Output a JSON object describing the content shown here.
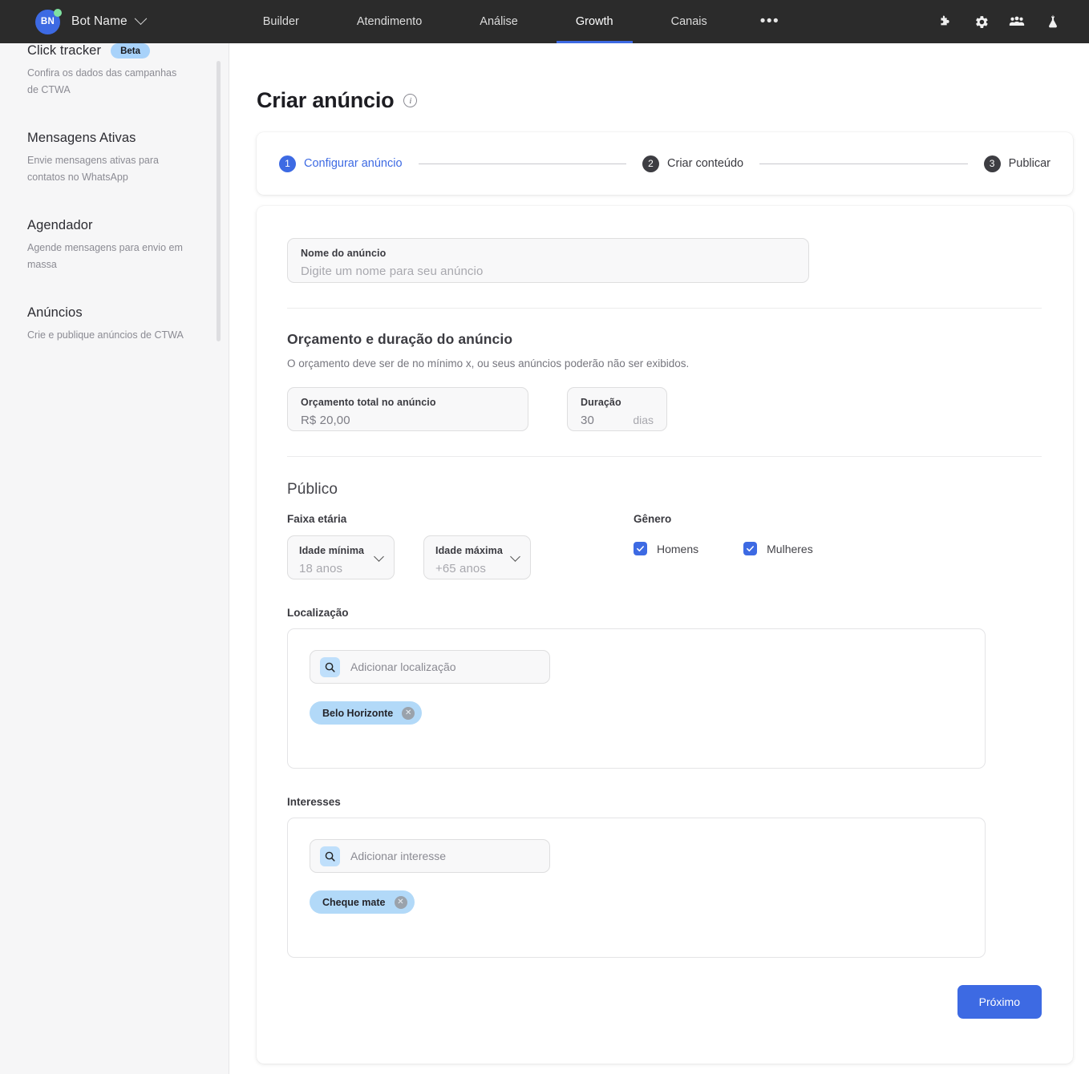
{
  "topnav": {
    "avatar_initials": "BN",
    "brand_name": "Bot Name",
    "items": [
      {
        "label": "Builder",
        "active": false
      },
      {
        "label": "Atendimento",
        "active": false
      },
      {
        "label": "Análise",
        "active": false
      },
      {
        "label": "Growth",
        "active": true
      },
      {
        "label": "Canais",
        "active": false
      }
    ],
    "more_label": "•••",
    "icons": [
      "puzzle-icon",
      "gear-icon",
      "people-icon",
      "flask-icon"
    ],
    "accent_color": "#3d6ae3",
    "background_color": "#2b2b2b",
    "status_dot_color": "#7fe2a1"
  },
  "sidebar": {
    "items": [
      {
        "title": "Click tracker",
        "badge": "Beta",
        "desc": "Confira os dados das campanhas de CTWA"
      },
      {
        "title": "Mensagens Ativas",
        "badge": "",
        "desc": "Envie mensagens ativas para contatos no WhatsApp"
      },
      {
        "title": "Agendador",
        "badge": "",
        "desc": "Agende mensagens para envio em massa"
      },
      {
        "title": "Anúncios",
        "badge": "",
        "desc": "Crie e publique anúncios de CTWA"
      }
    ]
  },
  "page": {
    "title": "Criar anúncio",
    "info_icon": "info-icon"
  },
  "stepper": {
    "steps": [
      {
        "number": "1",
        "label": "Configurar anúncio",
        "state": "active"
      },
      {
        "number": "2",
        "label": "Criar conteúdo",
        "state": "idle"
      },
      {
        "number": "3",
        "label": "Publicar",
        "state": "idle"
      }
    ]
  },
  "form": {
    "name_field": {
      "label": "Nome do anúncio",
      "placeholder": "Digite um nome para seu anúncio",
      "value": ""
    },
    "budget_section": {
      "title": "Orçamento e duração do anúncio",
      "subtitle": "O orçamento deve ser de no mínimo x, ou seus anúncios poderão não ser exibidos.",
      "budget": {
        "label": "Orçamento total no anúncio",
        "value": "R$ 20,00"
      },
      "duration": {
        "label": "Duração",
        "value": "30",
        "unit": "dias"
      }
    },
    "audience": {
      "title": "Público",
      "age_label": "Faixa etária",
      "gender_label": "Gênero",
      "age_min": {
        "label": "Idade mínima",
        "value": "18 anos"
      },
      "age_max": {
        "label": "Idade máxima",
        "value": "+65 anos"
      },
      "genders": [
        {
          "label": "Homens",
          "checked": true
        },
        {
          "label": "Mulheres",
          "checked": true
        }
      ]
    },
    "location": {
      "label": "Localização",
      "placeholder": "Adicionar localização",
      "chips": [
        "Belo Horizonte"
      ]
    },
    "interests": {
      "label": "Interesses",
      "placeholder": "Adicionar interesse",
      "chips": [
        "Cheque mate"
      ]
    },
    "next_button": "Próximo"
  }
}
